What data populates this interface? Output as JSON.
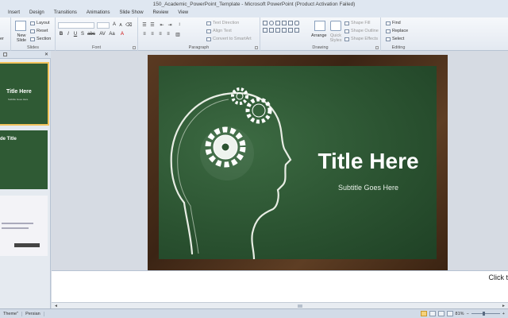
{
  "window": {
    "title": "150_Academic_PowerPoint_Template  -  Microsoft PowerPoint (Product Activation Failed)"
  },
  "ribbon_tabs": [
    "Insert",
    "Design",
    "Transitions",
    "Animations",
    "Slide Show",
    "Review",
    "View"
  ],
  "ribbon": {
    "clipboard": {
      "partial_label": "er"
    },
    "slides": {
      "label": "Slides",
      "new_slide": "New Slide",
      "layout": "Layout",
      "reset": "Reset",
      "section": "Section"
    },
    "font": {
      "label": "Font",
      "size_a": "A",
      "size_a_small": "A",
      "format": [
        "B",
        "I",
        "U",
        "S",
        "abc",
        "AV",
        "Aa",
        "A"
      ]
    },
    "paragraph": {
      "label": "Paragraph",
      "text_direction": "Text Direction",
      "align_text": "Align Text",
      "convert_smartart": "Convert to SmartArt"
    },
    "drawing": {
      "label": "Drawing",
      "arrange": "Arrange",
      "quick_styles": "Quick Styles",
      "shape_fill": "Shape Fill",
      "shape_outline": "Shape Outline",
      "shape_effects": "Shape Effects"
    },
    "editing": {
      "label": "Editing",
      "find": "Find",
      "replace": "Replace",
      "select": "Select"
    }
  },
  "thumbnails": [
    {
      "title": "Title Here",
      "subtitle": "Subtitle Goes Here"
    },
    {
      "title": "de Title"
    },
    {
      "title": ""
    }
  ],
  "slide": {
    "title": "Title Here",
    "subtitle": "Subtitle Goes Here"
  },
  "notes": {
    "placeholder": "Click t"
  },
  "statusbar": {
    "theme": "Theme\"",
    "language": "Persian",
    "zoom": "81%"
  },
  "colors": {
    "board": "#2b5331",
    "frame": "#4a2e1a",
    "selection": "#f3c35d"
  }
}
